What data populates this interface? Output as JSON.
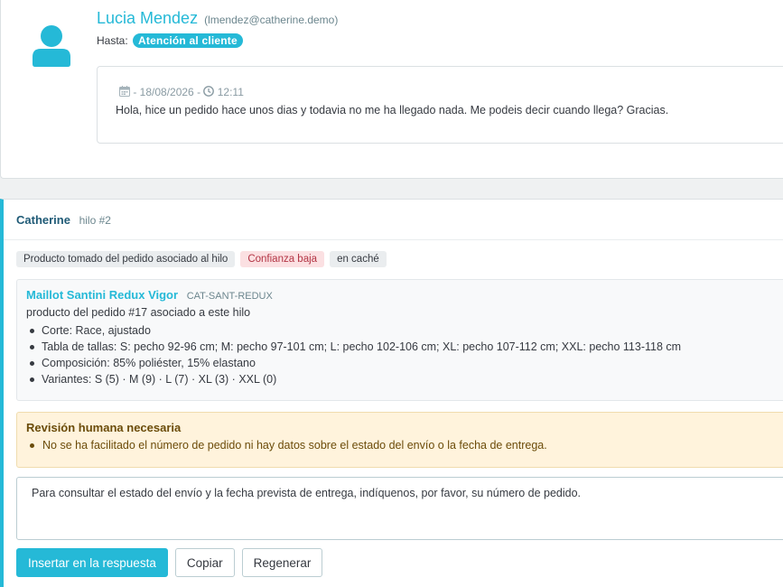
{
  "message": {
    "sender_name": "Lucia Mendez",
    "sender_email": "(lmendez@catherine.demo)",
    "to_label": "Hasta:",
    "to_badge": "Atención al cliente",
    "date_text": "- 18/08/2026 -",
    "time_text": "12:11",
    "body": "Hola, hice un pedido hace unos dias y todavia no me ha llegado nada. Me podeis decir cuando llega? Gracias."
  },
  "assistant": {
    "author": "Catherine",
    "thread": "hilo #2",
    "chips": [
      {
        "label": "Producto tomado del pedido asociado al hilo",
        "tone": "neutral"
      },
      {
        "label": "Confianza baja",
        "tone": "warn"
      },
      {
        "label": "en caché",
        "tone": "neutral"
      }
    ],
    "product": {
      "name": "Maillot Santini Redux Vigor",
      "reference": "CAT-SANT-REDUX",
      "subtitle": "producto del pedido #17 asociado a este hilo",
      "details": [
        "Corte: Race, ajustado",
        "Tabla de tallas: S: pecho 92-96 cm; M: pecho 97-101 cm; L: pecho 102-106 cm; XL: pecho 107-112 cm; XXL: pecho 113-118 cm",
        "Composición: 85% poliéster, 15% elastano",
        "Variantes: S (5) · M (9) · L (7) · XL (3) · XXL (0)"
      ]
    },
    "review": {
      "title": "Revisión humana necesaria",
      "items": [
        "No se ha facilitado el número de pedido ni hay datos sobre el estado del envío o la fecha de entrega."
      ]
    },
    "reply_text": "Para consultar el estado del envío y la fecha prevista de entrega, indíquenos, por favor, su número de pedido.",
    "buttons": {
      "insert": "Insertar en la respuesta",
      "copy": "Copiar",
      "regenerate": "Regenerar"
    }
  },
  "colors": {
    "accent": "#25b9d7",
    "warn_text": "#b33545",
    "review_bg": "#fff3dc"
  },
  "icons": [
    "user-icon",
    "calendar-icon",
    "clock-icon"
  ]
}
